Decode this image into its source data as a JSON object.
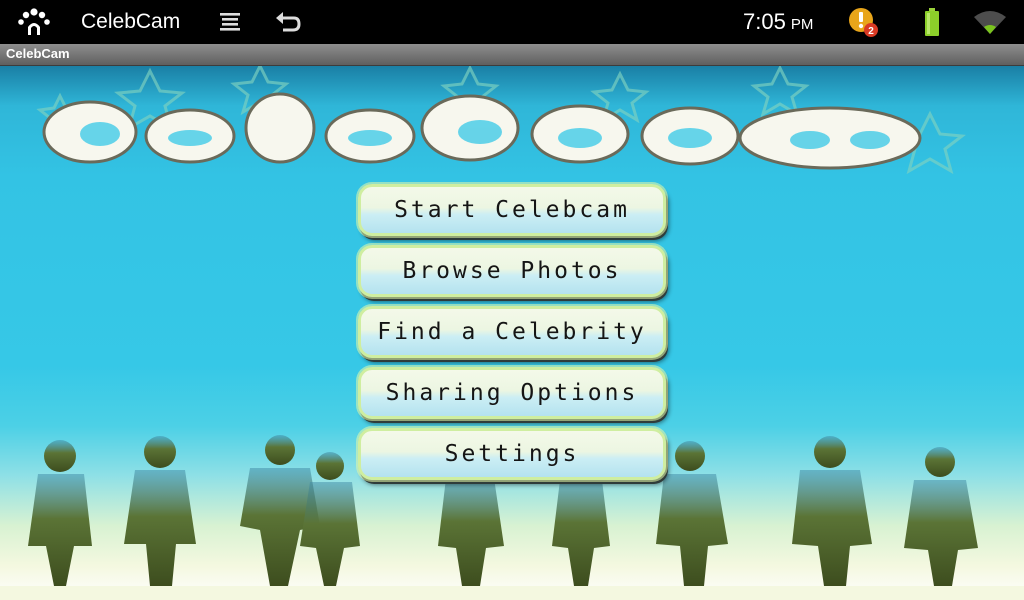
{
  "status_bar": {
    "app_name": "CelebCam",
    "time": "7:05",
    "ampm": "PM",
    "notification_count": "2",
    "icons": [
      "app-logo-icon",
      "menu-icon",
      "back-arrow-icon",
      "warning-icon",
      "battery-icon",
      "wifi-icon"
    ]
  },
  "title_bar": {
    "title": "CelebCam"
  },
  "menu": {
    "items": [
      {
        "label": "Start Celebcam"
      },
      {
        "label": "Browse Photos"
      },
      {
        "label": "Find a Celebrity"
      },
      {
        "label": "Sharing Options"
      },
      {
        "label": "Settings"
      }
    ]
  },
  "colors": {
    "sky": "#36c8e7",
    "button_fill": "#ecf6e2",
    "button_border": "#cfeea0",
    "silhouette": "#4a5d28"
  }
}
